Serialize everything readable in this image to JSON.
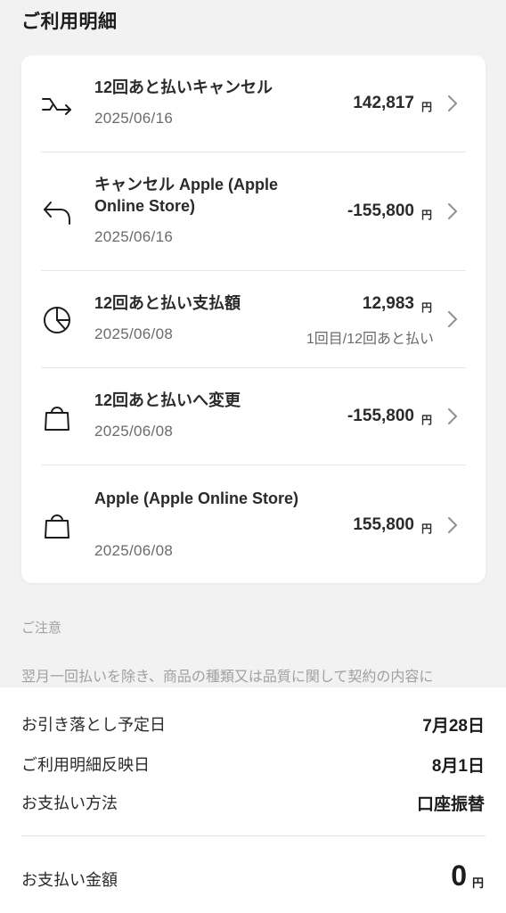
{
  "section_title": "ご利用明細",
  "currency_unit": "円",
  "transactions": [
    {
      "icon": "split-arrow-icon",
      "title": "12回あと払いキャンセル",
      "date": "2025/06/16",
      "amount": "142,817",
      "sub": ""
    },
    {
      "icon": "undo-arrow-icon",
      "title": "キャンセル Apple (Apple Online Store)",
      "date": "2025/06/16",
      "amount": "-155,800",
      "sub": ""
    },
    {
      "icon": "pie-chart-icon",
      "title": "12回あと払い支払額",
      "date": "2025/06/08",
      "amount": "12,983",
      "sub": "1回目/12回あと払い"
    },
    {
      "icon": "shopping-bag-icon",
      "title": "12回あと払いへ変更",
      "date": "2025/06/08",
      "amount": "-155,800",
      "sub": ""
    },
    {
      "icon": "shopping-bag-icon",
      "title": "Apple (Apple Online Store)",
      "date": "2025/06/08",
      "amount": "155,800",
      "sub": ""
    }
  ],
  "notice": {
    "label": "ご注意",
    "text": "翌月一回払いを除き、商品の種類又は品質に関して契約の内容に"
  },
  "summary": {
    "debit_date_label": "お引き落とし予定日",
    "debit_date_value": "7月28日",
    "reflect_date_label": "ご利用明細反映日",
    "reflect_date_value": "8月1日",
    "method_label": "お支払い方法",
    "method_value": "口座振替",
    "total_label": "お支払い金額",
    "total_value": "0"
  }
}
